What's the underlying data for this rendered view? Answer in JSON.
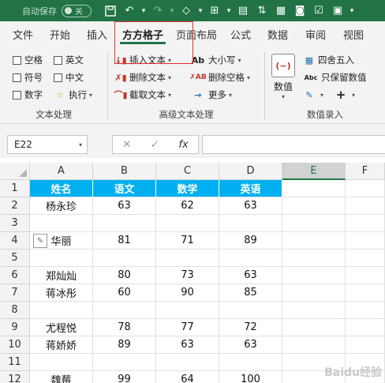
{
  "titlebar": {
    "autosave_label": "自动保存",
    "autosave_state": "关",
    "accent": "#217346"
  },
  "tabs": [
    {
      "label": "文件"
    },
    {
      "label": "开始"
    },
    {
      "label": "插入"
    },
    {
      "label": "方方格子",
      "active": true
    },
    {
      "label": "页面布局"
    },
    {
      "label": "公式"
    },
    {
      "label": "数据"
    },
    {
      "label": "审阅"
    },
    {
      "label": "视图"
    }
  ],
  "ribbon": {
    "text_group": {
      "label": "文本处理",
      "items": [
        "空格",
        "英文",
        "符号",
        "中文",
        "数字",
        "执行"
      ]
    },
    "adv_group": {
      "label": "高级文本处理",
      "insert_text": "插入文本",
      "delete_text": "删除文本",
      "extract_text": "截取文本",
      "case": "大小写",
      "delete_space": "删除空格",
      "more": "更多"
    },
    "num_group": {
      "label": "数值录入",
      "value_btn": "数值",
      "round": "四舍五入",
      "keep_value": "只保留数值"
    }
  },
  "formula_bar": {
    "name_box": "E22",
    "cancel": "✕",
    "confirm": "✓",
    "fx": "fx",
    "value": ""
  },
  "grid": {
    "columns": [
      "A",
      "B",
      "C",
      "D",
      "E",
      "F"
    ],
    "selected_column": "E",
    "rows": [
      {
        "num": "1",
        "cells": [
          "姓名",
          "语文",
          "数学",
          "英语"
        ],
        "header": true
      },
      {
        "num": "2",
        "cells": [
          "杨永珍",
          "63",
          "62",
          "63"
        ]
      },
      {
        "num": "3",
        "cells": [
          "",
          "",
          "",
          ""
        ]
      },
      {
        "num": "4",
        "cells": [
          "华丽",
          "81",
          "71",
          "89"
        ]
      },
      {
        "num": "5",
        "cells": [
          "",
          "",
          "",
          ""
        ]
      },
      {
        "num": "6",
        "cells": [
          "郑灿灿",
          "80",
          "73",
          "63"
        ]
      },
      {
        "num": "7",
        "cells": [
          "蒋冰彤",
          "60",
          "90",
          "85"
        ]
      },
      {
        "num": "8",
        "cells": [
          "",
          "",
          "",
          ""
        ]
      },
      {
        "num": "9",
        "cells": [
          "尤程悦",
          "78",
          "77",
          "72"
        ]
      },
      {
        "num": "10",
        "cells": [
          "蒋娇娇",
          "89",
          "63",
          "63"
        ]
      },
      {
        "num": "11",
        "cells": [
          "",
          "",
          "",
          ""
        ]
      },
      {
        "num": "12",
        "cells": [
          "魏莓",
          "99",
          "64",
          "100"
        ]
      }
    ],
    "header_fill": "#00b0f0"
  },
  "watermark": "Baidu经验"
}
